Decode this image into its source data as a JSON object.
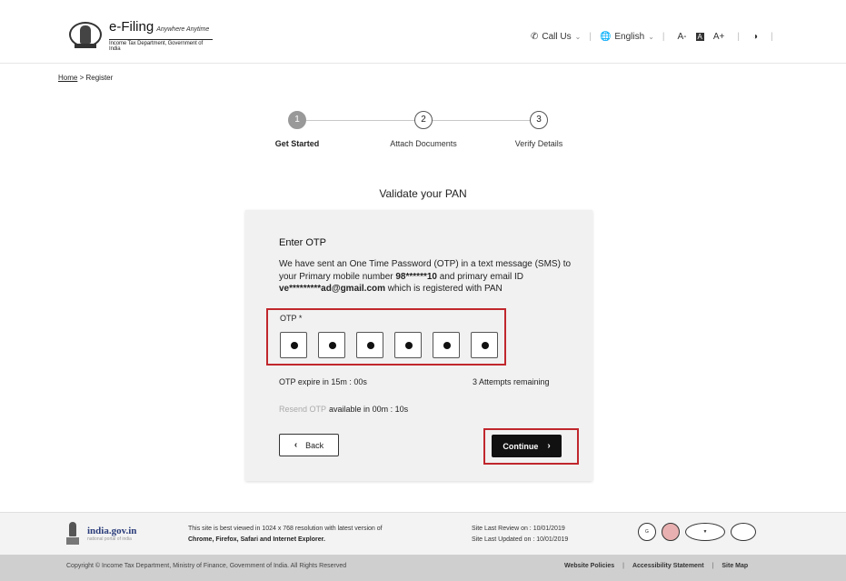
{
  "header": {
    "logo_title": "e-Filing",
    "logo_tagline": "Anywhere Anytime",
    "logo_subtitle": "Income Tax Department, Government of India",
    "call_us": "Call Us",
    "language": "English",
    "font_decrease": "A-",
    "font_reset": "A",
    "font_increase": "A+",
    "contrast_icon": "contrast-icon"
  },
  "breadcrumb": {
    "home": "Home",
    "separator": ">",
    "current": "Register"
  },
  "stepper": {
    "steps": [
      {
        "number": "1",
        "label": "Get Started",
        "active": true
      },
      {
        "number": "2",
        "label": "Attach Documents",
        "active": false
      },
      {
        "number": "3",
        "label": "Verify Details",
        "active": false
      }
    ]
  },
  "section_title": "Validate your PAN",
  "otp_card": {
    "title": "Enter OTP",
    "message_part1": "We have sent an One Time Password (OTP) in a text message (SMS) to your Primary mobile number ",
    "mobile": "98******10",
    "message_part2": " and primary email ID ",
    "email": "ve*********ad@gmail.com",
    "message_part3": " which is registered with PAN",
    "otp_label": "OTP *",
    "otp_count": 6,
    "otp_expire": "OTP expire in 15m : 00s",
    "attempts": "3 Attempts remaining",
    "resend_label": "Resend OTP",
    "resend_available": "available in 00m : 10s",
    "back_label": "Back",
    "continue_label": "Continue"
  },
  "footer": {
    "india_name": "india.gov.in",
    "india_sub": "national portal of india",
    "best_view_line1": "This site is best viewed in 1024 x 768 resolution with latest version of",
    "best_view_line2": "Chrome, Firefox, Safari and Internet Explorer.",
    "last_review": "Site Last Review on  :  10/01/2019",
    "last_updated": "Site Last Updated on  :  10/01/2019",
    "copyright": "Copyright © Income Tax Department, Ministry of Finance, Government of India. All Rights Reserved",
    "links": [
      "Website Policies",
      "Accessibility Statement",
      "Site Map"
    ]
  },
  "colors": {
    "highlight_red": "#c0272d",
    "continue_bg": "#111111",
    "card_bg": "#f1f1f1"
  }
}
